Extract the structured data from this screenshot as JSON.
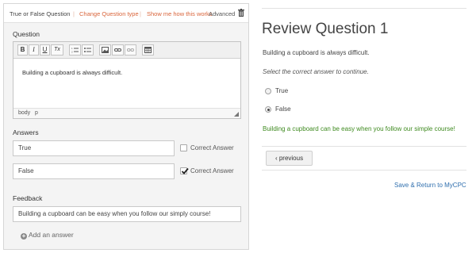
{
  "editor": {
    "header": {
      "type_label": "True or False Question",
      "separator": "|",
      "change_type": "Change Question type",
      "show_how": "Show me how this works",
      "advanced": "Advanced",
      "trash_icon": "trash-icon"
    },
    "question": {
      "label": "Question",
      "toolbar": {
        "bold": "B",
        "italic": "I",
        "underline": "U",
        "clear_format": "Tx",
        "icons": [
          "ordered-list-icon",
          "bullet-list-icon",
          "image-icon",
          "link-icon",
          "unlink-icon",
          "table-icon"
        ]
      },
      "body_text": "Building a cupboard is always difficult.",
      "status_path": [
        "body",
        "p"
      ]
    },
    "answers": {
      "label": "Answers",
      "items": [
        {
          "value": "True",
          "correct_label": "Correct Answer",
          "checked": false
        },
        {
          "value": "False",
          "correct_label": "Correct Answer",
          "checked": true
        }
      ]
    },
    "feedback": {
      "label": "Feedback",
      "value": "Building a cupboard can be easy when you follow our simply course!"
    },
    "add_answer": "Add an answer"
  },
  "preview": {
    "title": "Review Question 1",
    "statement": "Building a cupboard is always difficult.",
    "instruction": "Select the correct answer to continue.",
    "options": [
      {
        "label": "True",
        "selected": false
      },
      {
        "label": "False",
        "selected": true
      }
    ],
    "feedback": "Building a cupboard can be easy when you follow our simple course!",
    "previous_button": "‹ previous",
    "save_link": "Save & Return to MyCPC",
    "colors": {
      "feedback": "#3e8a1f",
      "link": "#2f6fae",
      "accent": "#d9643a"
    }
  }
}
